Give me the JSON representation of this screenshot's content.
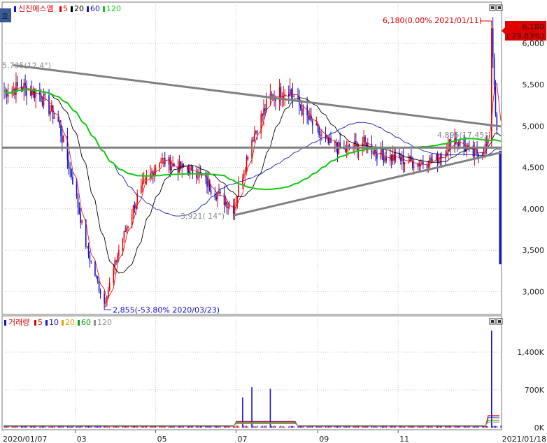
{
  "chart_data": [
    {
      "type": "candlestick",
      "title": "신진에스엠",
      "ylim": [
        2700,
        6250
      ],
      "yticks": [
        "6,000",
        "5,500",
        "5,000",
        "4,500",
        "4,000",
        "3,500",
        "3,000"
      ],
      "ytick_values": [
        6000,
        5500,
        5000,
        4500,
        4000,
        3500,
        3000
      ],
      "xticks": [
        "2020/01/07",
        "03",
        "05",
        "07",
        "09",
        "11",
        "2021/01/18"
      ],
      "grid": true,
      "legend_position": "top-left",
      "moving_averages": [
        {
          "label": "5",
          "color": "#e00000"
        },
        {
          "label": "20",
          "color": "#000000"
        },
        {
          "label": "60",
          "color": "#1a1ab8"
        },
        {
          "label": "120",
          "color": "#10c810"
        }
      ],
      "annotations": {
        "high": "6,180(0.00% 2021/01/11)",
        "low": "2,855(-53.80% 2020/03/23)",
        "left_high": "5,735(12.4°)",
        "mid_low": "3,921( 14°)",
        "pennant": "4,895(17.45°)",
        "current_price": "6,180",
        "current_change": "( 29.83%)"
      },
      "approx_path": {
        "close": [
          [
            "2020/01/07",
            5420
          ],
          [
            "2020/01/20",
            5480
          ],
          [
            "2020/02/03",
            5380
          ],
          [
            "2020/02/17",
            5050
          ],
          [
            "2020/02/28",
            4350
          ],
          [
            "2020/03/10",
            3500
          ],
          [
            "2020/03/23",
            2855
          ],
          [
            "2020/04/03",
            3500
          ],
          [
            "2020/04/17",
            4150
          ],
          [
            "2020/05/04",
            4600
          ],
          [
            "2020/05/18",
            4500
          ],
          [
            "2020/06/01",
            4450
          ],
          [
            "2020/06/15",
            4200
          ],
          [
            "2020/06/29",
            4000
          ],
          [
            "2020/07/13",
            4850
          ],
          [
            "2020/07/27",
            5350
          ],
          [
            "2020/08/10",
            5450
          ],
          [
            "2020/08/24",
            5100
          ],
          [
            "2020/09/07",
            4800
          ],
          [
            "2020/09/21",
            4700
          ],
          [
            "2020/10/05",
            4800
          ],
          [
            "2020/10/19",
            4650
          ],
          [
            "2020/11/02",
            4600
          ],
          [
            "2020/11/16",
            4550
          ],
          [
            "2020/11/30",
            4600
          ],
          [
            "2020/12/14",
            4850
          ],
          [
            "2020/12/28",
            4650
          ],
          [
            "2021/01/08",
            4760
          ],
          [
            "2021/01/11",
            6180
          ],
          [
            "2021/01/18",
            3900
          ]
        ]
      }
    },
    {
      "type": "bar",
      "title": "거래량",
      "ylim": [
        0,
        1850000
      ],
      "yticks": [
        "1,400K",
        "700K",
        "0K"
      ],
      "ytick_values": [
        1400000,
        700000,
        0
      ],
      "moving_averages": [
        {
          "label": "5",
          "color": "#e00000"
        },
        {
          "label": "10",
          "color": "#1a1ab8"
        },
        {
          "label": "20",
          "color": "#e0a000"
        },
        {
          "label": "60",
          "color": "#10a010"
        },
        {
          "label": "120",
          "color": "#909090"
        }
      ],
      "approx_spikes": [
        {
          "date": "2020/07/06",
          "value": 560000
        },
        {
          "date": "2020/07/13",
          "value": 750000
        },
        {
          "date": "2020/07/27",
          "value": 720000
        },
        {
          "date": "2021/01/11",
          "value": 1800000
        }
      ]
    }
  ],
  "ui": {
    "tab_label": "호",
    "price_label": "신진에스엠",
    "volume_label": "거래량",
    "price_ma": [
      "5",
      "20",
      "60",
      "120"
    ],
    "vol_ma": [
      "5",
      "10",
      "20",
      "60",
      "120"
    ]
  }
}
